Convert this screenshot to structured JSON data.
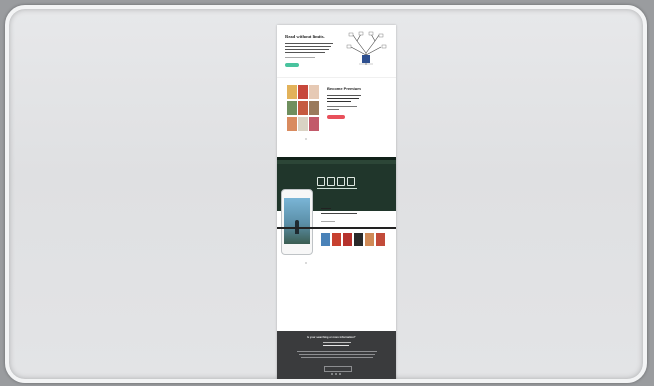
{
  "hero": {
    "title": "Read without limits."
  },
  "premium": {
    "title": "Become Premium"
  },
  "footer": {
    "title": "Is your searching or more information?"
  },
  "colors": {
    "accent_green": "#49c39e",
    "accent_red": "#e8505b",
    "dark_band": "#20362b",
    "footer": "#3a3b3d"
  }
}
